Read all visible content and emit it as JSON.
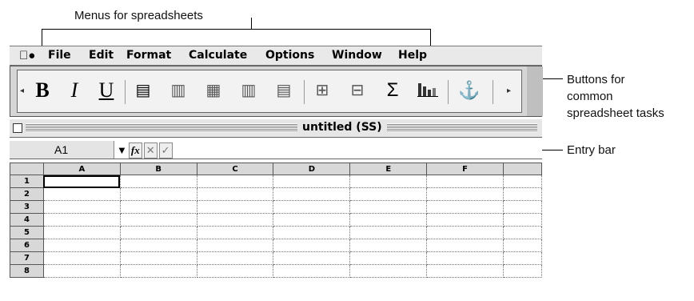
{
  "callouts": {
    "menus": "Menus for spreadsheets",
    "buttons_line1": "Buttons for",
    "buttons_line2": "common",
    "buttons_line3": "spreadsheet tasks",
    "entry": "Entry bar"
  },
  "menubar": {
    "apple_icon": "apple-menu-icon",
    "items": [
      "File",
      "Edit",
      "Format",
      "Calculate",
      "Options",
      "Window",
      "Help"
    ]
  },
  "toolbar": {
    "buttons": [
      {
        "icon": "bold-icon",
        "glyph": "B"
      },
      {
        "icon": "italic-icon",
        "glyph": "I"
      },
      {
        "icon": "underline-icon",
        "glyph": "U"
      },
      {
        "icon": "align-left-icon",
        "glyph": "▤"
      },
      {
        "icon": "align-center-icon",
        "glyph": "▥"
      },
      {
        "icon": "align-right-icon",
        "glyph": "▦"
      },
      {
        "icon": "justify-icon",
        "glyph": "▥"
      },
      {
        "icon": "fill-icon",
        "glyph": "▤"
      },
      {
        "icon": "insert-cells-icon",
        "glyph": "⊞"
      },
      {
        "icon": "delete-cells-icon",
        "glyph": "⊟"
      },
      {
        "icon": "sum-icon",
        "glyph": "Σ"
      },
      {
        "icon": "chart-icon",
        "glyph": "▮"
      },
      {
        "icon": "anchor-icon",
        "glyph": "⚓"
      }
    ]
  },
  "window": {
    "title": "untitled (SS)"
  },
  "entry": {
    "cell_ref": "A1",
    "fx": "fx",
    "cancel": "✕",
    "accept": "✓"
  },
  "grid": {
    "columns": [
      "A",
      "B",
      "C",
      "D",
      "E",
      "F",
      ""
    ],
    "rows": [
      "1",
      "2",
      "3",
      "4",
      "5",
      "6",
      "7",
      "8"
    ]
  }
}
